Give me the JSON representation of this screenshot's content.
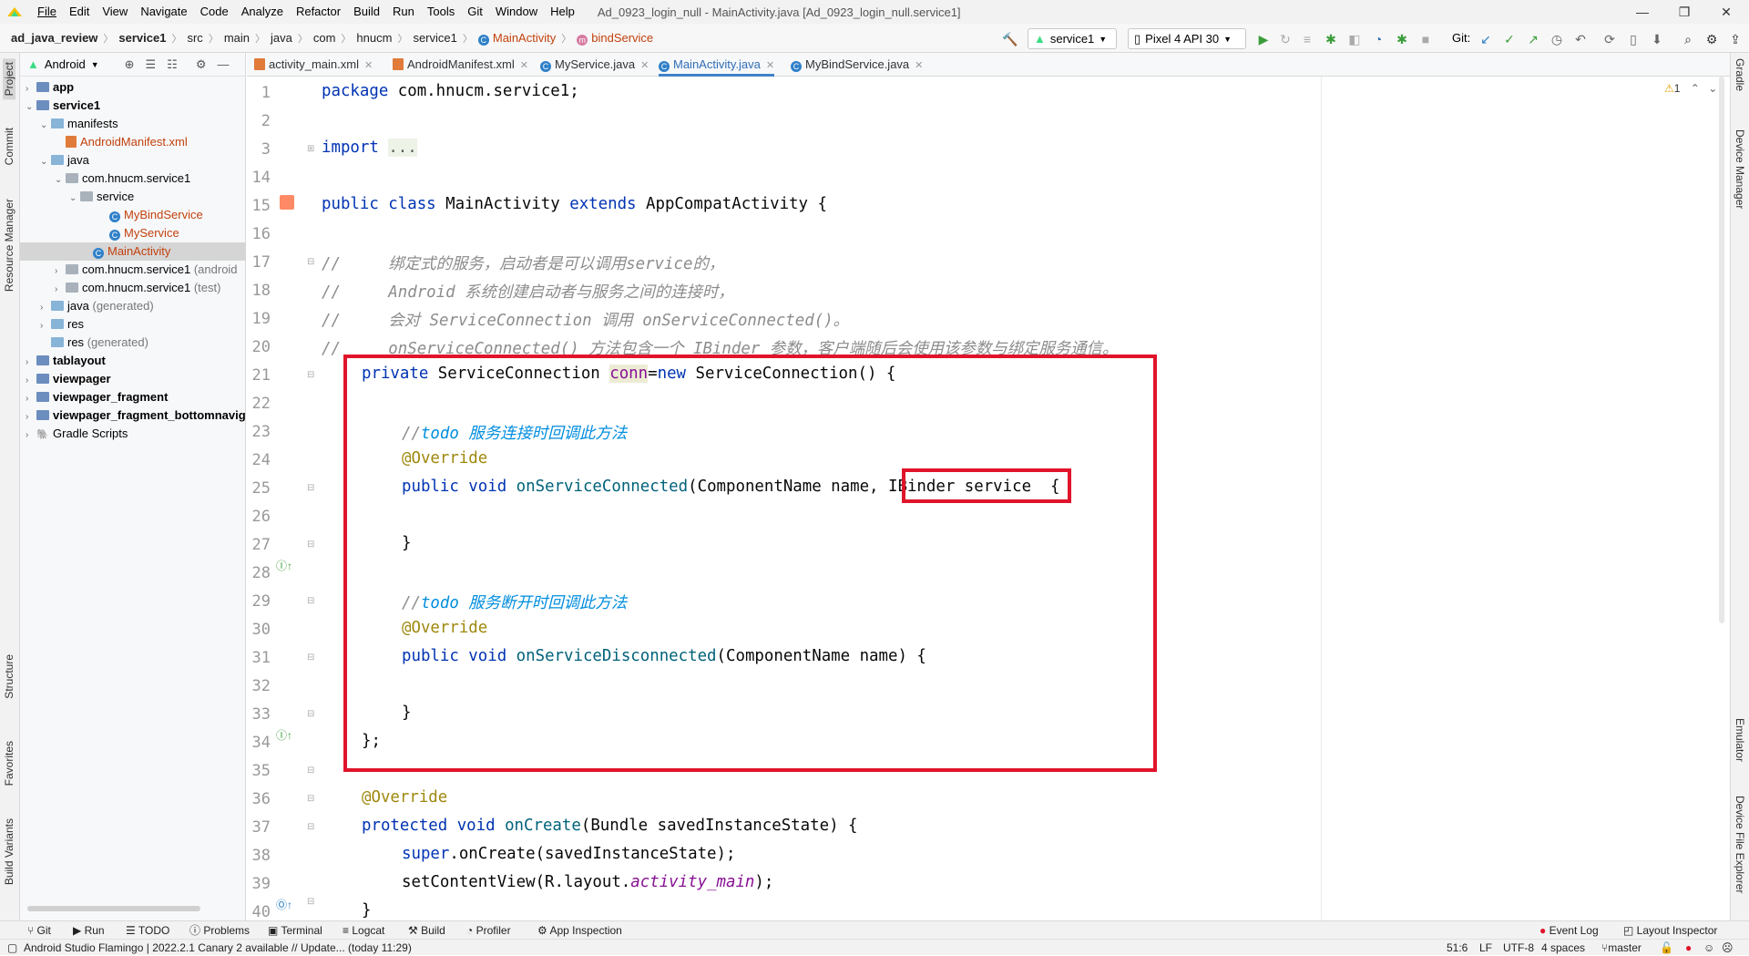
{
  "menubar": {
    "items": [
      "File",
      "Edit",
      "View",
      "Navigate",
      "Code",
      "Analyze",
      "Refactor",
      "Build",
      "Run",
      "Tools",
      "Git",
      "Window",
      "Help"
    ],
    "window_title": "Ad_0923_login_null - MainActivity.java [Ad_0923_login_null.service1]"
  },
  "breadcrumb": {
    "project": "ad_java_review",
    "module": "service1",
    "parts": [
      "src",
      "main",
      "java",
      "com",
      "hnucm",
      "service1"
    ],
    "class": "MainActivity",
    "method": "bindService"
  },
  "toolbar": {
    "run_config": "service1",
    "device": "Pixel 4 API 30",
    "git_label": "Git:"
  },
  "left_strip": [
    "Project",
    "Commit",
    "Resource Manager",
    "Structure",
    "Favorites",
    "Build Variants"
  ],
  "right_strip": [
    "Gradle",
    "Device Manager",
    "Emulator",
    "Device File Explorer"
  ],
  "project_panel": {
    "view": "Android",
    "tree": [
      {
        "label": "app",
        "extra": ""
      },
      {
        "label": "service1",
        "extra": ""
      },
      {
        "label": "manifests",
        "extra": ""
      },
      {
        "label": "AndroidManifest.xml",
        "extra": ""
      },
      {
        "label": "java",
        "extra": ""
      },
      {
        "label": "com.hnucm.service1",
        "extra": ""
      },
      {
        "label": "service",
        "extra": ""
      },
      {
        "label": "MyBindService",
        "extra": ""
      },
      {
        "label": "MyService",
        "extra": ""
      },
      {
        "label": "MainActivity",
        "extra": ""
      },
      {
        "label": "com.hnucm.service1",
        "extra": "(android"
      },
      {
        "label": "com.hnucm.service1",
        "extra": "(test)"
      },
      {
        "label": "java",
        "extra": "(generated)"
      },
      {
        "label": "res",
        "extra": ""
      },
      {
        "label": "res",
        "extra": "(generated)"
      },
      {
        "label": "tablayout",
        "extra": ""
      },
      {
        "label": "viewpager",
        "extra": ""
      },
      {
        "label": "viewpager_fragment",
        "extra": ""
      },
      {
        "label": "viewpager_fragment_bottomnavig",
        "extra": ""
      },
      {
        "label": "Gradle Scripts",
        "extra": ""
      }
    ]
  },
  "editor_tabs": [
    "activity_main.xml",
    "AndroidManifest.xml",
    "MyService.java",
    "MainActivity.java",
    "MyBindService.java"
  ],
  "editor": {
    "warning_count": "1",
    "line_numbers": [
      "1",
      "2",
      "3",
      "14",
      "15",
      "16",
      "17",
      "18",
      "19",
      "20",
      "21",
      "22",
      "23",
      "24",
      "25",
      "26",
      "27",
      "28",
      "29",
      "30",
      "31",
      "32",
      "33",
      "34",
      "35",
      "36",
      "37",
      "38",
      "39",
      "40"
    ],
    "code": {
      "l1a": "package",
      "l1b": " com.hnucm.service1;",
      "l3a": "import",
      "l3b": "...",
      "l15a": "public class",
      "l15b": " MainActivity ",
      "l15c": "extends",
      "l15d": " AppCompatActivity {",
      "l17": "//     绑定式的服务，启动者是可以调用service的，",
      "l18": "//     Android 系统创建启动者与服务之间的连接时，",
      "l19": "//     会对 ServiceConnection 调用 onServiceConnected()。",
      "l20": "//     onServiceConnected() 方法包含一个 IBinder 参数，客户端随后会使用该参数与绑定服务通信。",
      "l21a": "private",
      "l21b": " ServiceConnection ",
      "l21c": "conn",
      "l21d": "=",
      "l21e": "new",
      "l21f": " ServiceConnection() {",
      "l23a": "//",
      "l23b": "todo 服务连接时回调此方法",
      "l24": "@Override",
      "l25a": "public void",
      "l25b": "onServiceConnected",
      "l25c": "(ComponentName name,",
      "l25d": "IBinder service",
      "l25e": " {",
      "l27": "}",
      "l29a": "//",
      "l29b": "todo 服务断开时回调此方法",
      "l30": "@Override",
      "l31a": "public void",
      "l31b": "onServiceDisconnected",
      "l31c": "(ComponentName name) {",
      "l33": "}",
      "l34": "};",
      "l36": "@Override",
      "l37a": "protected void",
      "l37b": "onCreate",
      "l37c": "(Bundle savedInstanceState) {",
      "l38a": "super",
      "l38b": ".onCreate(savedInstanceState);",
      "l39a": "setContentView(R.layout.",
      "l39b": "activity_main",
      "l39c": ");",
      "l40": "}"
    }
  },
  "bottom_tabs": [
    "Git",
    "Run",
    "TODO",
    "Problems",
    "Terminal",
    "Logcat",
    "Build",
    "Profiler",
    "App Inspection"
  ],
  "bottom_right_tabs": [
    "Event Log",
    "Layout Inspector"
  ],
  "status": {
    "message": "Android Studio Flamingo | 2022.2.1 Canary 2 available // Update... (today 11:29)",
    "position": "51:6",
    "line_sep": "LF",
    "encoding": "UTF-8",
    "indent": "4 spaces",
    "branch": "master"
  },
  "colors": {
    "accent": "#4083c9",
    "highlight_box": "#e0142a",
    "keyword": "#0033b3",
    "annotation": "#9e880d",
    "comment": "#8c8c8c",
    "todo": "#008dde",
    "method": "#00627a"
  }
}
